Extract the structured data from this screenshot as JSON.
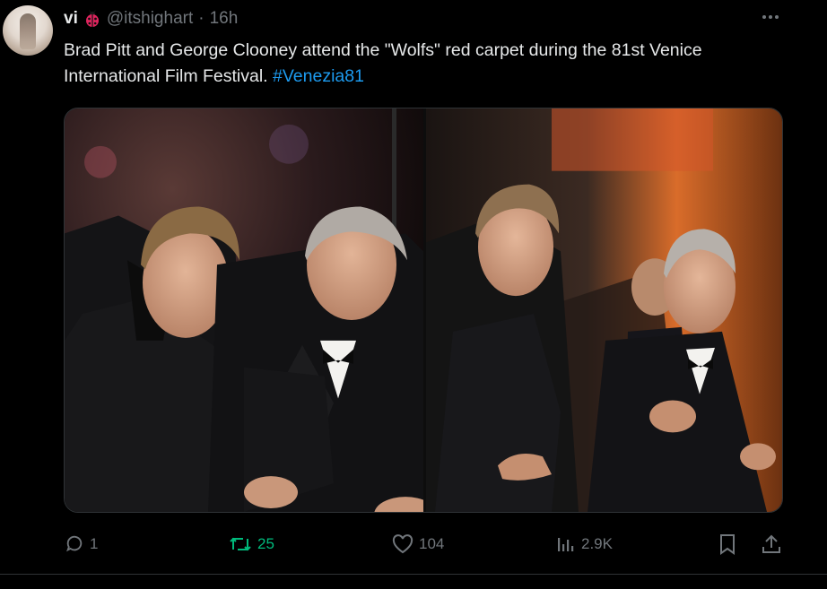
{
  "tweet": {
    "author_name": "vi",
    "handle": "@itshighart",
    "separator": "·",
    "time": "16h",
    "text_main": "Brad Pitt and George Clooney attend the \"Wolfs\" red carpet during the 81st Venice International Film Festival.",
    "hashtag": "#Venezia81"
  },
  "actions": {
    "replies": "1",
    "reposts": "25",
    "likes": "104",
    "views": "2.9K"
  },
  "colors": {
    "background": "#000000",
    "text": "#e7e9ea",
    "muted": "#71767b",
    "link": "#1d9bf0",
    "repost": "#00ba7c",
    "border": "#2f3336"
  },
  "icons": {
    "badge": "ladybug-icon",
    "more": "more-icon",
    "reply": "reply-icon",
    "repost": "repost-icon",
    "like": "heart-icon",
    "views": "views-icon",
    "bookmark": "bookmark-icon",
    "share": "share-icon"
  }
}
